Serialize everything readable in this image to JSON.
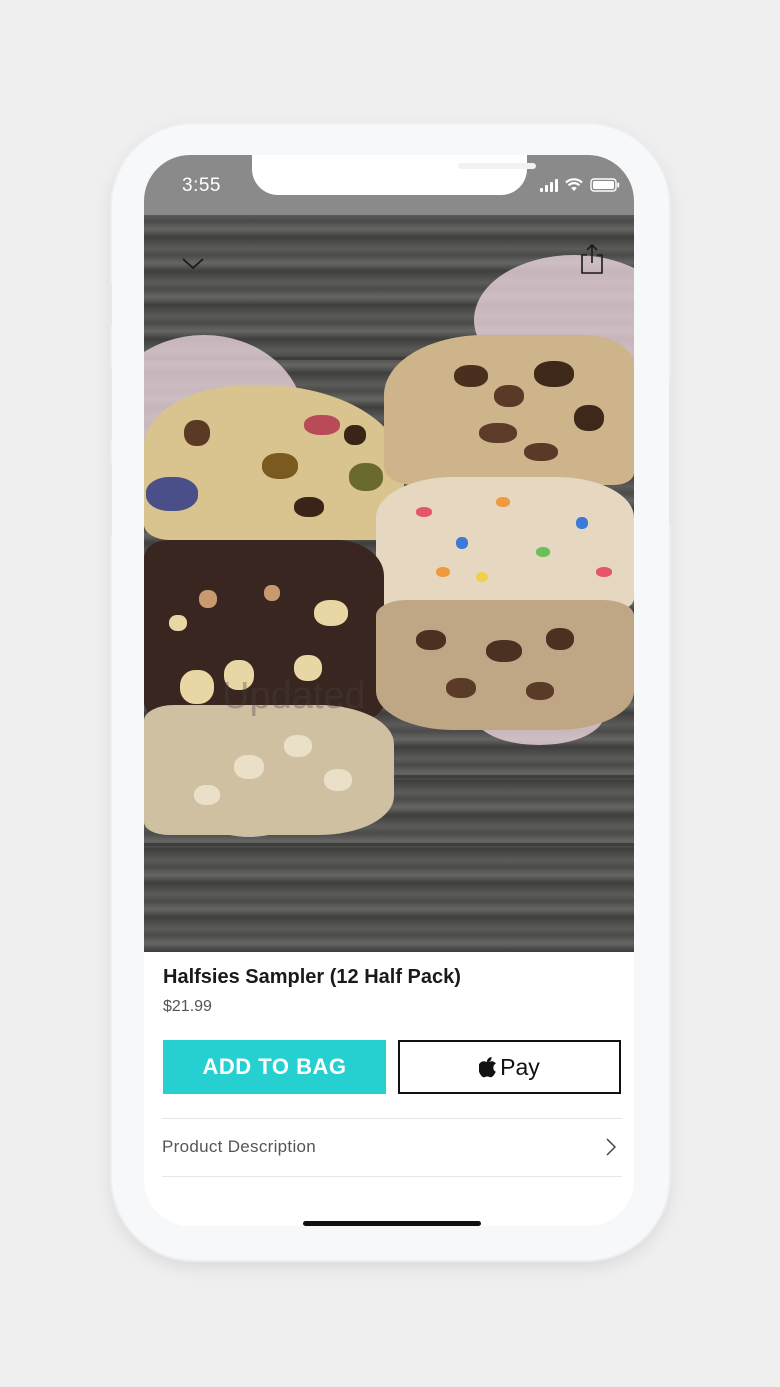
{
  "status_bar": {
    "time": "3:55"
  },
  "hero": {
    "collapse_icon": "chevron-down-icon",
    "share_icon": "share-icon",
    "watermark": "Updated"
  },
  "product": {
    "title": "Halfsies Sampler (12 Half Pack)",
    "price": "$21.99"
  },
  "actions": {
    "add_to_bag_label": "ADD TO BAG",
    "apple_pay_label": "Pay"
  },
  "details": {
    "description_label": "Product Description"
  },
  "colors": {
    "accent": "#27d0d0",
    "status_bar": "#8a8a8a"
  }
}
